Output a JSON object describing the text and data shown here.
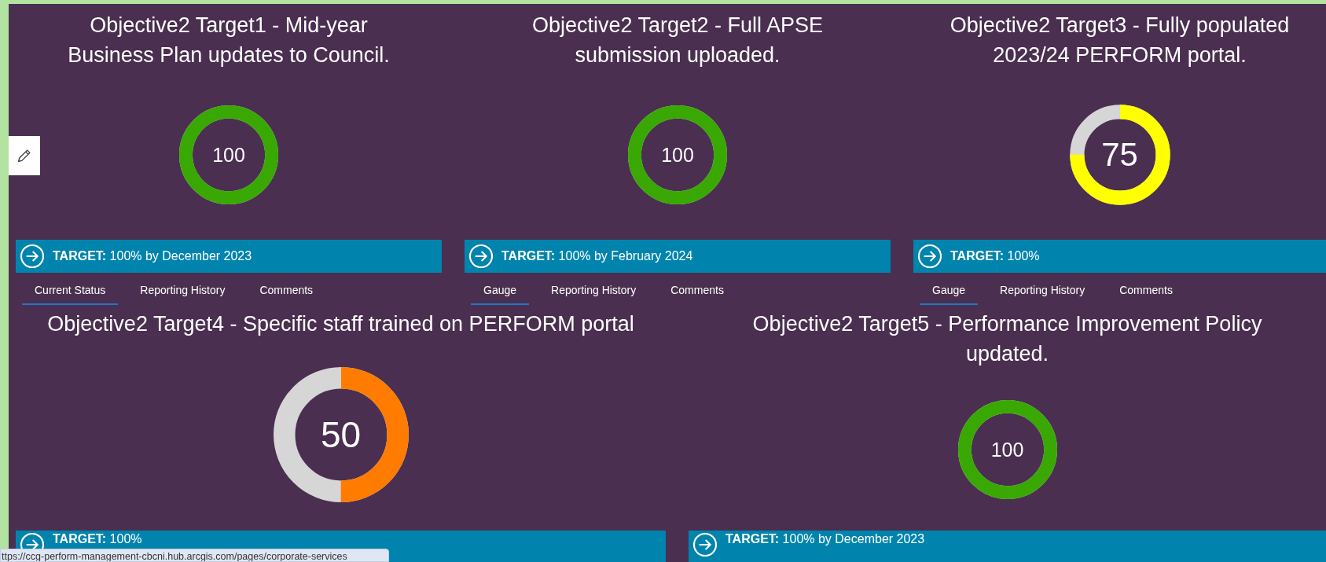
{
  "edit_button": {
    "kind": "pencil"
  },
  "top_row": [
    {
      "title": "Objective2 Target1 - Mid-year Business Plan updates to Council.",
      "gauge": {
        "value": "100",
        "level": 1,
        "color": "#3aa802"
      },
      "target": {
        "label": "TARGET:",
        "text": "100% by December 2023"
      },
      "tabs": [
        {
          "label": "Current Status",
          "selected": true
        },
        {
          "label": "Reporting History",
          "selected": false
        },
        {
          "label": "Comments",
          "selected": false
        }
      ]
    },
    {
      "title": "Objective2 Target2 - Full APSE submission uploaded.",
      "gauge": {
        "value": "100",
        "level": 1,
        "color": "#3aa802"
      },
      "target": {
        "label": "TARGET:",
        "text": "100% by February 2024"
      },
      "tabs": [
        {
          "label": "Gauge",
          "selected": true
        },
        {
          "label": "Reporting History",
          "selected": false
        },
        {
          "label": "Comments",
          "selected": false
        }
      ]
    },
    {
      "title": "Objective2 Target3 - Fully populated 2023/24 PERFORM portal.",
      "gauge": {
        "value": "75",
        "level": 0.75,
        "color": "#ffff00"
      },
      "target": {
        "label": "TARGET:",
        "text": "100%"
      },
      "tabs": [
        {
          "label": "Gauge",
          "selected": true
        },
        {
          "label": "Reporting History",
          "selected": false
        },
        {
          "label": "Comments",
          "selected": false
        }
      ]
    }
  ],
  "bottom_row": [
    {
      "title": "Objective2 Target4 - Specific staff trained on PERFORM portal",
      "gauge": {
        "value": "50",
        "level": 0.5,
        "color": "#ff7c00"
      },
      "target": {
        "label": "TARGET:",
        "text": "100%"
      }
    },
    {
      "title": "Objective2 Target5 - Performance Improvement Policy updated.",
      "gauge": {
        "value": "100",
        "level": 1,
        "color": "#3aa802"
      },
      "target": {
        "label": "TARGET:",
        "text": "100% by December 2023"
      }
    }
  ],
  "status_url": "ttps://ccg-perform-management-cbcni.hub.arcgis.com/pages/corporate-services"
}
